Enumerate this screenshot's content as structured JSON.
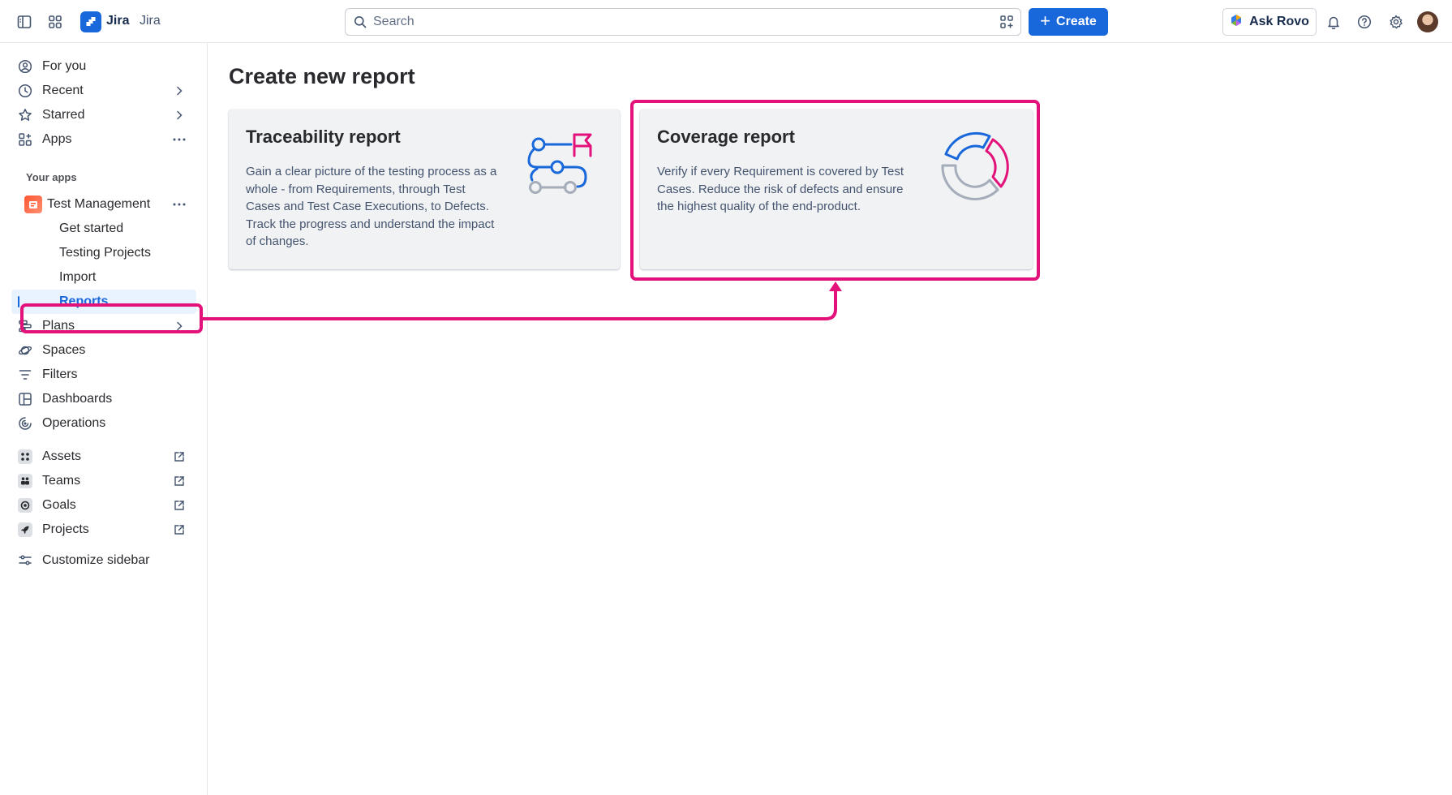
{
  "topbar": {
    "brand": "Jira",
    "site_name": "Jira",
    "search_placeholder": "Search",
    "create_label": "Create",
    "ask_rovo_label": "Ask Rovo"
  },
  "sidebar": {
    "items": [
      {
        "label": "For you",
        "icon": "person-circle-icon"
      },
      {
        "label": "Recent",
        "icon": "clock-icon"
      },
      {
        "label": "Starred",
        "icon": "star-icon"
      },
      {
        "label": "Apps",
        "icon": "apps-icon"
      }
    ],
    "your_apps_label": "Your apps",
    "app": {
      "label": "Test Management",
      "children": [
        "Get started",
        "Testing Projects",
        "Import",
        "Reports"
      ],
      "active": "Reports"
    },
    "items2": [
      {
        "label": "Plans",
        "icon": "plans-icon"
      },
      {
        "label": "Spaces",
        "icon": "spaces-icon"
      },
      {
        "label": "Filters",
        "icon": "filter-icon"
      },
      {
        "label": "Dashboards",
        "icon": "dashboard-icon"
      },
      {
        "label": "Operations",
        "icon": "operations-icon"
      }
    ],
    "external": [
      {
        "label": "Assets",
        "icon": "assets-icon"
      },
      {
        "label": "Teams",
        "icon": "teams-icon"
      },
      {
        "label": "Goals",
        "icon": "goals-icon"
      },
      {
        "label": "Projects",
        "icon": "projects-icon"
      }
    ],
    "customize_label": "Customize sidebar"
  },
  "main": {
    "title": "Create new report",
    "cards": [
      {
        "title": "Traceability report",
        "description": "Gain a clear picture of the testing process as a whole - from Requirements, through Test Cases and Test Case Executions, to Defects. Track the progress and understand the impact of changes.",
        "icon": "traceability-illustration"
      },
      {
        "title": "Coverage report",
        "description": "Verify if every Requirement is covered by Test Cases. Reduce the risk of defects and ensure the highest quality of the end-product.",
        "icon": "coverage-illustration"
      }
    ]
  },
  "colors": {
    "primary": "#1868db",
    "highlight": "#e2127a",
    "card_bg": "#f1f2f4"
  }
}
